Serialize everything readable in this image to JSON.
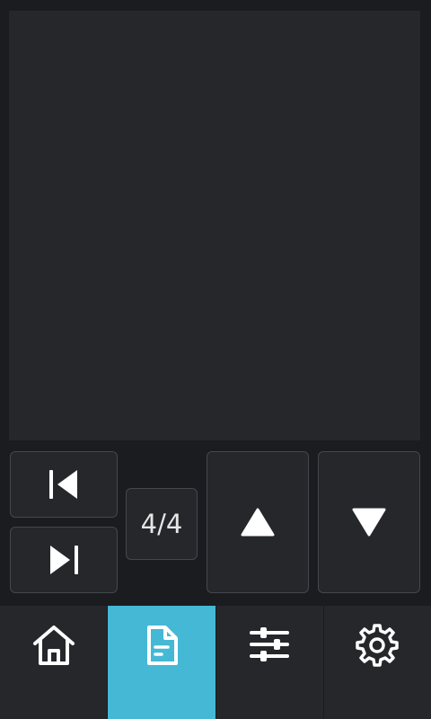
{
  "colors": {
    "background": "#1a1c1f",
    "panel": "#25272b",
    "border": "#44474c",
    "accent": "#45b8d6",
    "icon": "#ffffff"
  },
  "controls": {
    "first_icon": "skip-to-first-icon",
    "last_icon": "skip-to-last-icon",
    "page_indicator": "4/4",
    "up_icon": "arrow-up-icon",
    "down_icon": "arrow-down-icon"
  },
  "nav": {
    "items": [
      {
        "icon": "home-icon",
        "active": false
      },
      {
        "icon": "document-icon",
        "active": true
      },
      {
        "icon": "sliders-icon",
        "active": false
      },
      {
        "icon": "gear-icon",
        "active": false
      }
    ]
  }
}
